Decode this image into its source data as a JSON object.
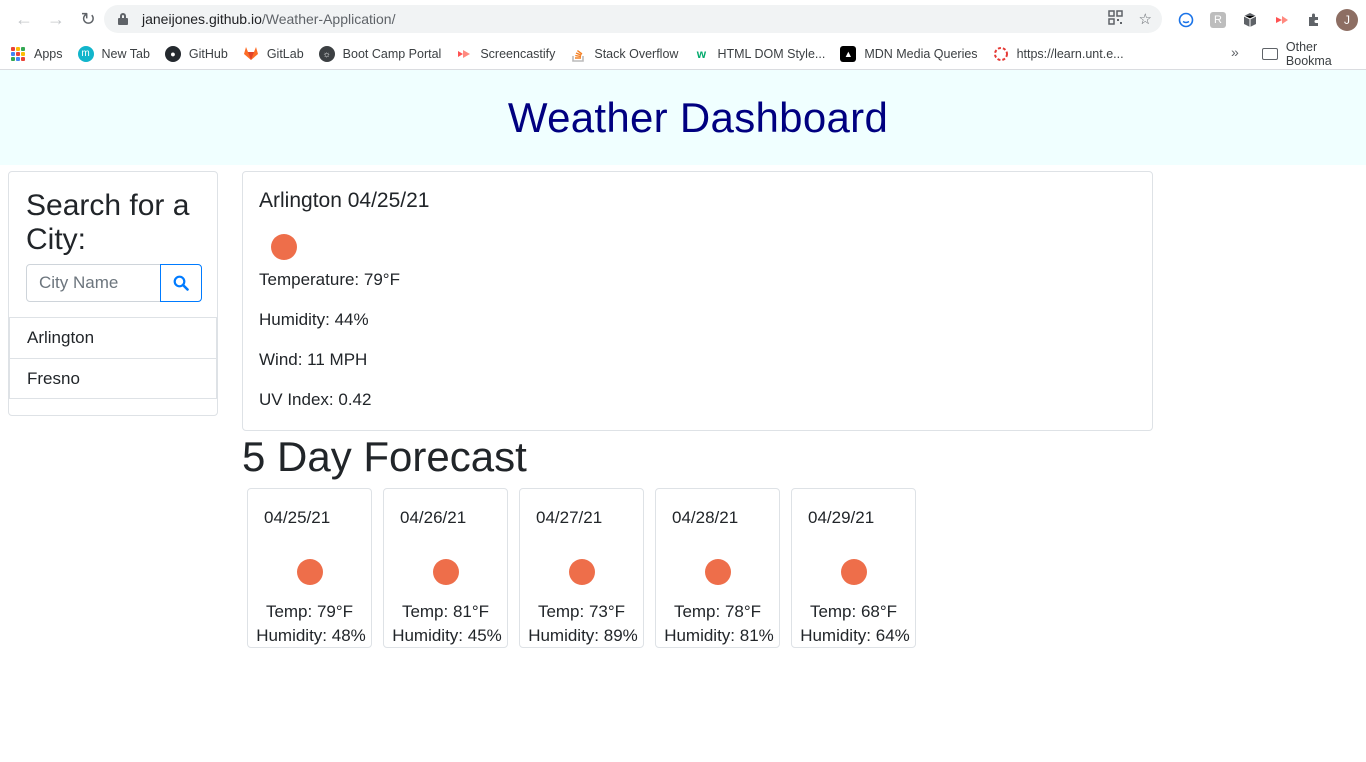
{
  "browser": {
    "url_host": "janeijones.github.io",
    "url_path": "/Weather-Application/",
    "bookmarks": [
      {
        "label": "Apps",
        "icon": "apps-grid-icon"
      },
      {
        "label": "New Tab",
        "icon": "new-tab-icon"
      },
      {
        "label": "GitHub",
        "icon": "github-icon"
      },
      {
        "label": "GitLab",
        "icon": "gitlab-icon"
      },
      {
        "label": "Boot Camp Portal",
        "icon": "globe-icon"
      },
      {
        "label": "Screencastify",
        "icon": "screencastify-icon"
      },
      {
        "label": "Stack Overflow",
        "icon": "stackoverflow-icon"
      },
      {
        "label": "HTML DOM Style...",
        "icon": "w3schools-icon"
      },
      {
        "label": "MDN Media Queries",
        "icon": "mdn-icon"
      },
      {
        "label": "https://learn.unt.e...",
        "icon": "unt-icon"
      }
    ],
    "bookmarks_more": "»",
    "other_bookmarks": "Other Bookma",
    "avatar_initial": "J"
  },
  "header": {
    "title": "Weather Dashboard"
  },
  "search": {
    "title": "Search for a City:",
    "placeholder": "City Name",
    "history": [
      "Arlington",
      "Fresno"
    ]
  },
  "current": {
    "title": "Arlington 04/25/21",
    "icon": "sun-icon",
    "temperature": "Temperature: 79°F",
    "humidity": "Humidity: 44%",
    "wind": "Wind: 11 MPH",
    "uv": "UV Index: 0.42"
  },
  "forecast": {
    "heading": "5 Day Forecast",
    "days": [
      {
        "date": "04/25/21",
        "temp": "Temp: 79°F",
        "humidity": "Humidity: 48%"
      },
      {
        "date": "04/26/21",
        "temp": "Temp: 81°F",
        "humidity": "Humidity: 45%"
      },
      {
        "date": "04/27/21",
        "temp": "Temp: 73°F",
        "humidity": "Humidity: 89%"
      },
      {
        "date": "04/28/21",
        "temp": "Temp: 78°F",
        "humidity": "Humidity: 81%"
      },
      {
        "date": "04/29/21",
        "temp": "Temp: 68°F",
        "humidity": "Humidity: 64%"
      }
    ]
  },
  "colors": {
    "title": "#000080",
    "jumbotron": "#f0ffff",
    "sun": "#ee6e4a",
    "button_border": "#007bff"
  }
}
